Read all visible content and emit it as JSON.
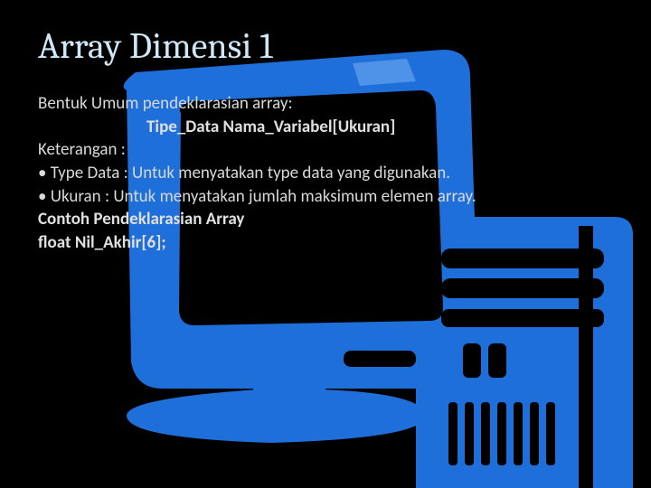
{
  "title": "Array Dimensi 1",
  "lines": {
    "intro": "Bentuk Umum pendeklarasian array:",
    "syntax": "Tipe_Data Nama_Variabel[Ukuran]",
    "ketLabel": "Keterangan :",
    "bullet1": "• Type Data : Untuk menyatakan type data yang digunakan.",
    "bullet2": "• Ukuran : Untuk menyatakan jumlah maksimum elemen array.",
    "contohLabel": "Contoh Pendeklarasian Array",
    "example": "float Nil_Akhir[6];"
  }
}
